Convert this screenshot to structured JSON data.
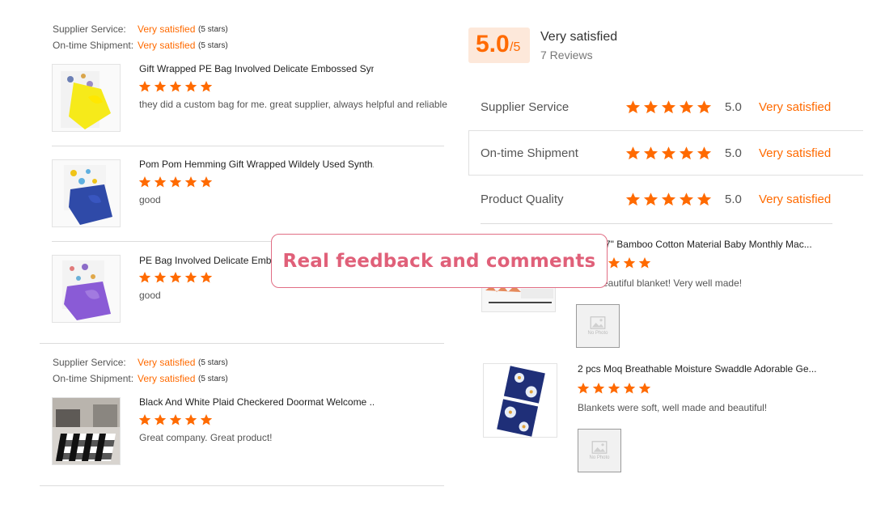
{
  "colors": {
    "accent": "#ff6a00",
    "banner_text": "#e06079",
    "banner_border": "#e16e84"
  },
  "left": {
    "group1": {
      "supplier_label": "Supplier Service:",
      "supplier_value": "Very satisfied",
      "supplier_stars": "(5 stars)",
      "shipment_label": "On-time Shipment:",
      "shipment_value": "Very satisfied",
      "shipment_stars": "(5 stars)"
    },
    "reviews": [
      {
        "title": "Gift Wrapped PE Bag Involved Delicate Embossed Syn...",
        "rating": 5,
        "comment": "they did a custom bag for me. great supplier, always helpful and reliable"
      },
      {
        "title": "Pom Pom Hemming Gift Wrapped Wildely Used Synth...",
        "rating": 5,
        "comment": "good"
      },
      {
        "title": "PE Bag Involved Delicate Embos",
        "rating": 5,
        "comment": "good"
      }
    ],
    "group2": {
      "supplier_label": "Supplier Service:",
      "supplier_value": "Very satisfied",
      "supplier_stars": "(5 stars)",
      "shipment_label": "On-time Shipment:",
      "shipment_value": "Very satisfied",
      "shipment_stars": "(5 stars)",
      "review": {
        "title": "Black And White Plaid Checkered Doormat Welcome ...",
        "rating": 5,
        "comment": "Great company. Great product!"
      }
    }
  },
  "right": {
    "score": "5.0",
    "score_out_of": "/5",
    "summary_title": "Very satisfied",
    "summary_reviews": "7 Reviews",
    "rows": [
      {
        "label": "Supplier Service",
        "stars": 5,
        "score": "5.0",
        "value": "Very satisfied"
      },
      {
        "label": "On-time Shipment",
        "stars": 5,
        "score": "5.0",
        "value": "Very satisfied"
      },
      {
        "label": "Product Quality",
        "stars": 5,
        "score": "5.0",
        "value": "Very satisfied"
      }
    ],
    "reviews": [
      {
        "title": "7\" Bamboo Cotton Material Baby Monthly Mac...",
        "rating": 5,
        "comment": "eautiful blanket! Very well made!",
        "no_photo": "No Photo"
      },
      {
        "title": "2 pcs Moq Breathable Moisture Swaddle Adorable Ge...",
        "rating": 5,
        "comment": "Blankets were soft, well made and beautiful!",
        "no_photo": "No Photo"
      }
    ]
  },
  "banner": {
    "text": "Real feedback and comments"
  }
}
